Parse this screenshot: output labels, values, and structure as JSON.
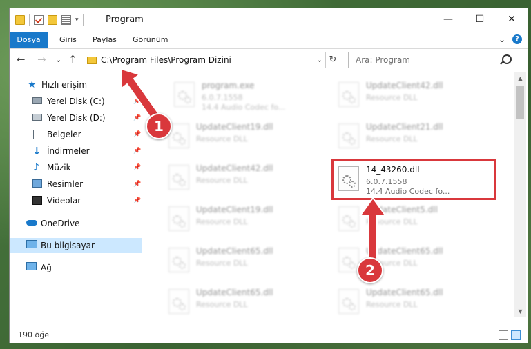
{
  "window": {
    "title": "Program",
    "controls": {
      "minimize": "—",
      "maximize": "☐",
      "close": "✕"
    }
  },
  "ribbon": {
    "tabs": [
      "Dosya",
      "Giriş",
      "Paylaş",
      "Görünüm"
    ],
    "collapse": "⌄",
    "help": "?"
  },
  "address": {
    "back": "←",
    "forward": "→",
    "recent": "⌄",
    "up": "↑",
    "path": "C:\\Program Files\\Program Dizini",
    "dropdown": "⌄",
    "refresh": "↻"
  },
  "search": {
    "placeholder": "Ara: Program"
  },
  "nav": {
    "quick_access": "Hızlı erişim",
    "items": [
      {
        "label": "Yerel Disk (C:)",
        "pin": "📌"
      },
      {
        "label": "Yerel Disk (D:)",
        "pin": "📌"
      },
      {
        "label": "Belgeler",
        "pin": "📌"
      },
      {
        "label": "İndirmeler",
        "pin": "📌"
      },
      {
        "label": "Müzik",
        "pin": "📌"
      },
      {
        "label": "Resimler",
        "pin": "📌"
      },
      {
        "label": "Videolar",
        "pin": "📌"
      }
    ],
    "onedrive": "OneDrive",
    "this_pc": "Bu bilgisayar",
    "network": "Ağ"
  },
  "files": [
    {
      "name": "program.exe",
      "line2": "6.0.7.1558",
      "line3": "14.4 Audio Codec fo..."
    },
    {
      "name": "UpdateClient42.dll",
      "line2": "Resource DLL",
      "line3": ""
    },
    {
      "name": "UpdateClient19.dll",
      "line2": "Resource DLL",
      "line3": ""
    },
    {
      "name": "UpdateClient21.dll",
      "line2": "Resource DLL",
      "line3": ""
    },
    {
      "name": "UpdateClient42.dll",
      "line2": "Resource DLL",
      "line3": ""
    },
    {
      "name": "14_43260.dll",
      "line2": "6.0.7.1558",
      "line3": "14.4 Audio Codec fo..."
    },
    {
      "name": "UpdateClient19.dll",
      "line2": "Resource DLL",
      "line3": ""
    },
    {
      "name": "UpdateClient5.dll",
      "line2": "Resource DLL",
      "line3": ""
    },
    {
      "name": "UpdateClient65.dll",
      "line2": "Resource DLL",
      "line3": ""
    },
    {
      "name": "UpdateClient65.dll",
      "line2": "Resource DLL",
      "line3": ""
    },
    {
      "name": "UpdateClient65.dll",
      "line2": "Resource DLL",
      "line3": ""
    },
    {
      "name": "UpdateClient65.dll",
      "line2": "Resource DLL",
      "line3": ""
    }
  ],
  "scrollbar": {
    "up": "▲",
    "down": "▼"
  },
  "status": {
    "count": "190 öğe"
  },
  "annotations": {
    "badge1": "1",
    "badge2": "2"
  },
  "colors": {
    "accent": "#1979ca",
    "highlight": "#d9383c",
    "selection": "#cce8ff"
  }
}
